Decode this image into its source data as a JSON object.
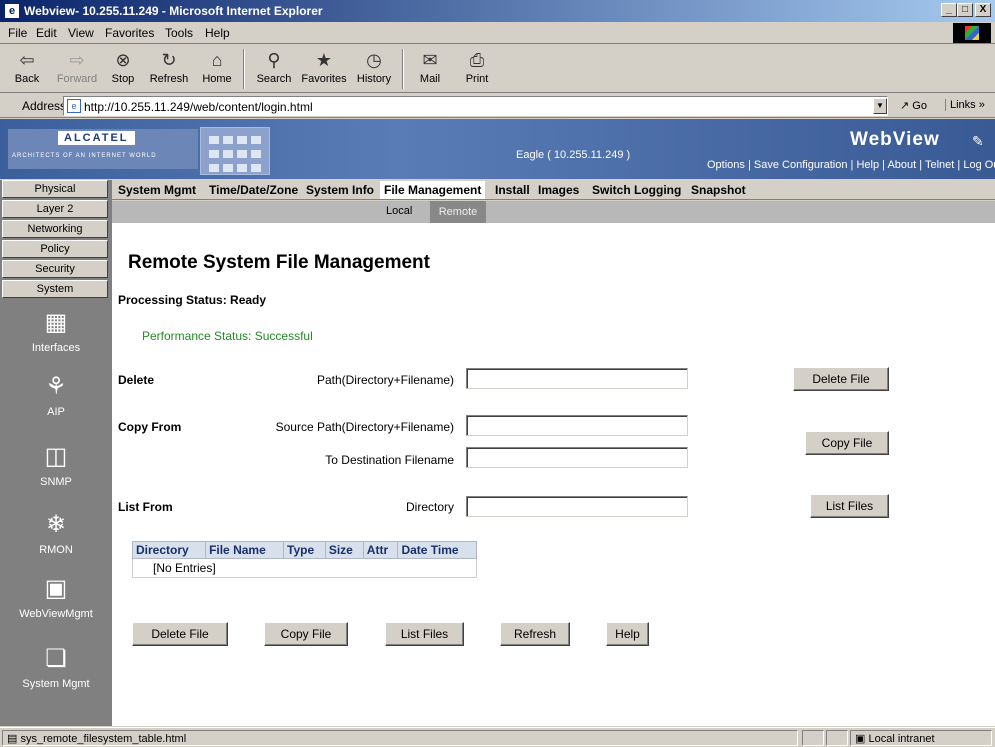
{
  "window": {
    "title": "Webview- 10.255.11.249 - Microsoft Internet Explorer",
    "min": "_",
    "max": "□",
    "close": "X"
  },
  "menu": [
    "File",
    "Edit",
    "View",
    "Favorites",
    "Tools",
    "Help"
  ],
  "toolbar": {
    "back": "Back",
    "forward": "Forward",
    "stop": "Stop",
    "refresh": "Refresh",
    "home": "Home",
    "search": "Search",
    "favorites": "Favorites",
    "history": "History",
    "mail": "Mail",
    "print": "Print"
  },
  "address": {
    "label": "Address",
    "url": "http://10.255.11.249/web/content/login.html",
    "go": "Go",
    "links": "Links »"
  },
  "banner": {
    "logo": "ALCATEL",
    "tagline": "ARCHITECTS OF AN INTERNET WORLD",
    "host": "Eagle  ( 10.255.11.249 )",
    "brand": "WebView",
    "links": [
      "Options",
      "Save Configuration",
      "Help",
      "About",
      "Telnet",
      "Log Out"
    ]
  },
  "leftnav": {
    "tabs": [
      "Physical",
      "Layer 2",
      "Networking",
      "Policy",
      "Security",
      "System"
    ],
    "items": [
      {
        "label": "Interfaces",
        "icon": "interfaces-icon"
      },
      {
        "label": "AIP",
        "icon": "aip-icon"
      },
      {
        "label": "SNMP",
        "icon": "snmp-icon"
      },
      {
        "label": "RMON",
        "icon": "rmon-icon"
      },
      {
        "label": "WebViewMgmt",
        "icon": "webview-mgmt-icon"
      },
      {
        "label": "System Mgmt",
        "icon": "system-mgmt-icon"
      }
    ]
  },
  "topmenu": [
    "System Mgmt",
    "Time/Date/Zone",
    "System Info",
    "File Management",
    "Install",
    "Images",
    "Switch Logging",
    "Snapshot"
  ],
  "submenu": {
    "local": "Local",
    "remote": "Remote"
  },
  "page": {
    "title": "Remote System File Management",
    "processing": "Processing Status: Ready",
    "performance": "Performance Status: Successful"
  },
  "form": {
    "delete": {
      "section": "Delete",
      "label": "Path(Directory+Filename)",
      "value": "",
      "button": "Delete File"
    },
    "copy": {
      "section": "Copy From",
      "source_label": "Source Path(Directory+Filename)",
      "source_value": "",
      "dest_label": "To Destination Filename",
      "dest_value": "",
      "button": "Copy File"
    },
    "list": {
      "section": "List From",
      "label": "Directory",
      "value": "",
      "button": "List Files"
    }
  },
  "table": {
    "columns": [
      "Directory",
      "File Name",
      "Type",
      "Size",
      "Attr",
      "Date Time"
    ],
    "empty": "[No Entries]"
  },
  "actions": [
    "Delete File",
    "Copy File",
    "List Files",
    "Refresh",
    "Help"
  ],
  "statusbar": {
    "text": "sys_remote_filesystem_table.html",
    "zone": "Local intranet"
  }
}
